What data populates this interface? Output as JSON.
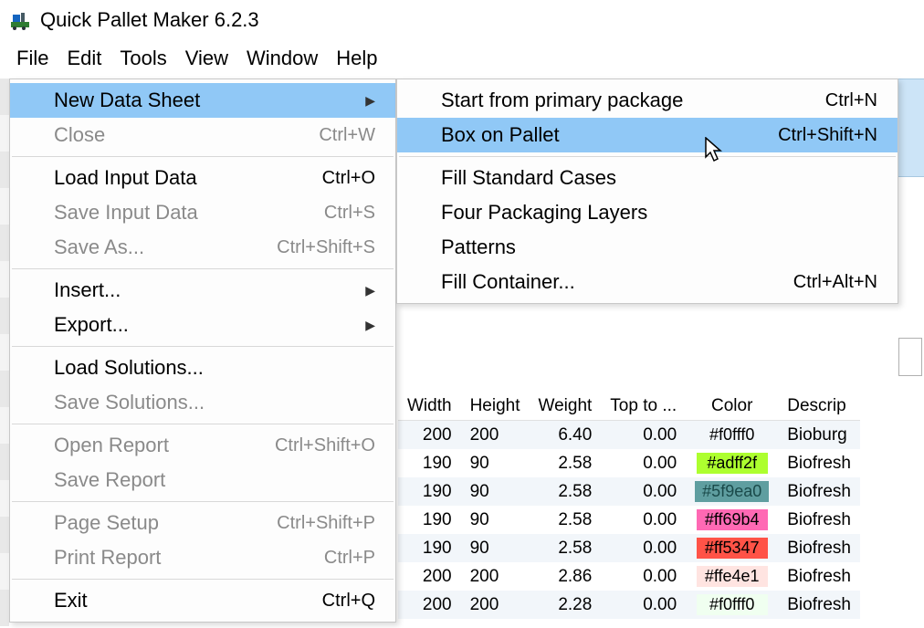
{
  "app": {
    "title": "Quick Pallet Maker 6.2.3"
  },
  "menubar": [
    "File",
    "Edit",
    "Tools",
    "View",
    "Window",
    "Help"
  ],
  "file_menu": {
    "new_data_sheet": "New Data Sheet",
    "close": "Close",
    "close_sc": "Ctrl+W",
    "load_input": "Load Input Data",
    "load_input_sc": "Ctrl+O",
    "save_input": "Save Input Data",
    "save_input_sc": "Ctrl+S",
    "save_as": "Save As...",
    "save_as_sc": "Ctrl+Shift+S",
    "insert": "Insert...",
    "export": "Export...",
    "load_solutions": "Load Solutions...",
    "save_solutions": "Save Solutions...",
    "open_report": "Open Report",
    "open_report_sc": "Ctrl+Shift+O",
    "save_report": "Save Report",
    "page_setup": "Page Setup",
    "page_setup_sc": "Ctrl+Shift+P",
    "print_report": "Print Report",
    "print_report_sc": "Ctrl+P",
    "exit": "Exit",
    "exit_sc": "Ctrl+Q"
  },
  "submenu": {
    "start_primary": "Start from primary package",
    "start_primary_sc": "Ctrl+N",
    "box_on_pallet": "Box on Pallet",
    "box_on_pallet_sc": "Ctrl+Shift+N",
    "fill_standard": "Fill Standard Cases",
    "four_layers": "Four Packaging Layers",
    "patterns": "Patterns",
    "fill_container": "Fill Container...",
    "fill_container_sc": "Ctrl+Alt+N"
  },
  "table": {
    "headers": {
      "width": "Width",
      "height": "Height",
      "weight": "Weight",
      "topto": "Top to ...",
      "color": "Color",
      "descrip": "Descrip"
    },
    "rows": [
      {
        "width": "200",
        "height": "200",
        "weight": "6.40",
        "topto": "0.00",
        "color": "#f0fff0",
        "desc": "Bioburg",
        "striped": true
      },
      {
        "width": "190",
        "height": "90",
        "weight": "2.58",
        "topto": "0.00",
        "color": "#adff2f",
        "desc": "Biofresh",
        "striped": false,
        "swatchbg": "#adff2f"
      },
      {
        "width": "190",
        "height": "90",
        "weight": "2.58",
        "topto": "0.00",
        "color": "#5f9ea0",
        "desc": "Biofresh",
        "striped": true,
        "swatchbg": "#5f9ea0",
        "swatchfg": "#1a4a4a"
      },
      {
        "width": "190",
        "height": "90",
        "weight": "2.58",
        "topto": "0.00",
        "color": "#ff69b4",
        "desc": "Biofresh",
        "striped": false,
        "swatchbg": "#ff69b4"
      },
      {
        "width": "190",
        "height": "90",
        "weight": "2.58",
        "topto": "0.00",
        "color": "#ff5347",
        "desc": "Biofresh",
        "striped": true,
        "swatchbg": "#ff5347"
      },
      {
        "width": "200",
        "height": "200",
        "weight": "2.86",
        "topto": "0.00",
        "color": "#ffe4e1",
        "desc": "Biofresh",
        "striped": false,
        "swatchbg": "#ffe4e1"
      },
      {
        "width": "200",
        "height": "200",
        "weight": "2.28",
        "topto": "0.00",
        "color": "#f0fff0",
        "desc": "Biofresh",
        "striped": true,
        "swatchbg": "#f0fff0"
      }
    ]
  }
}
